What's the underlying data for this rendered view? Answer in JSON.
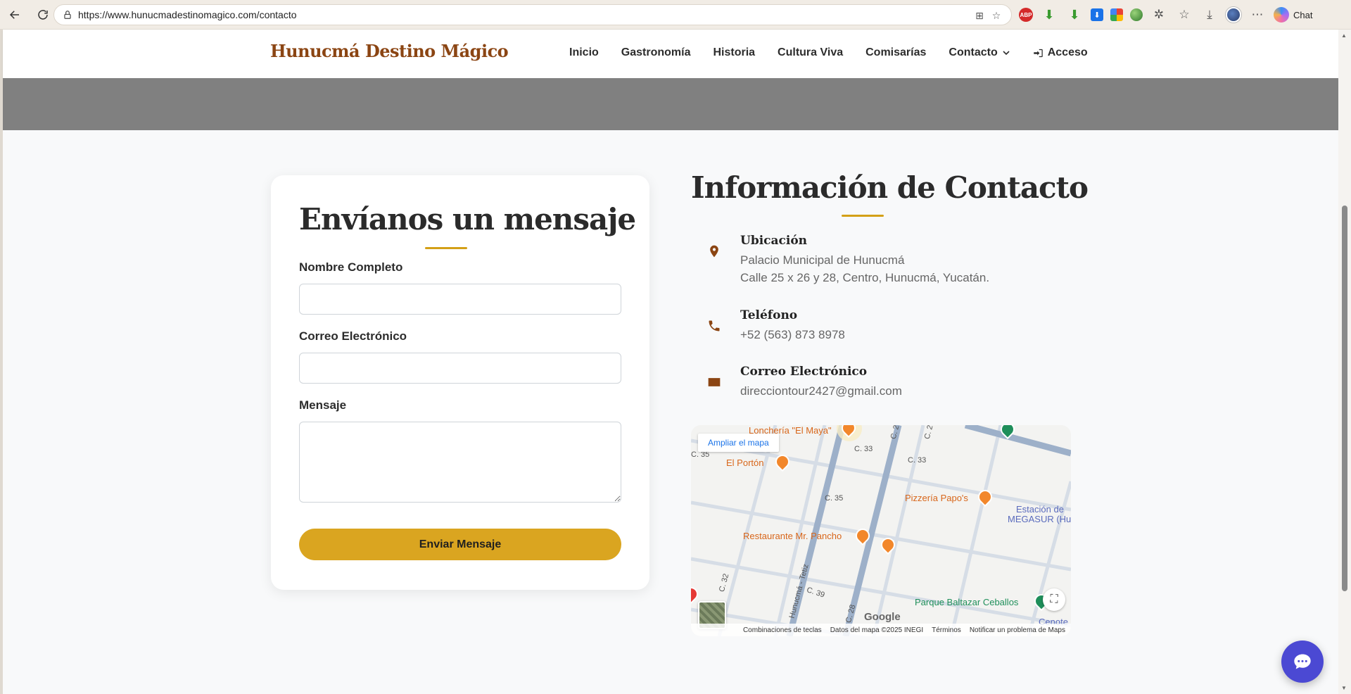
{
  "browser": {
    "url": "https://www.hunucmadestinomagico.com/contacto",
    "chat_label": "Chat",
    "abp_label": "ABP"
  },
  "site": {
    "brand": "Hunucmá Destino Mágico",
    "brand_color": "#8b4513",
    "accent_color": "#daa520",
    "nav": {
      "inicio": "Inicio",
      "gastronomia": "Gastronomía",
      "historia": "Historia",
      "cultura": "Cultura Viva",
      "comisarias": "Comisarías",
      "contacto": "Contacto",
      "acceso": "Acceso"
    }
  },
  "form": {
    "title": "Envíanos un mensaje",
    "name_label": "Nombre Completo",
    "name_value": "",
    "email_label": "Correo Electrónico",
    "email_value": "",
    "message_label": "Mensaje",
    "message_value": "",
    "submit_label": "Enviar Mensaje"
  },
  "contact": {
    "title": "Información de Contacto",
    "location_title": "Ubicación",
    "location_line1": "Palacio Municipal de Hunucmá",
    "location_line2": "Calle 25 x 26 y 28, Centro, Hunucmá, Yucatán.",
    "phone_title": "Teléfono",
    "phone_value": "+52 (563) 873 8978",
    "email_title": "Correo Electrónico",
    "email_value": "direcciontour2427@gmail.com"
  },
  "map": {
    "enlarge": "Ampliar el mapa",
    "pois": {
      "loncheria": "Lonchería \"El Maya\"",
      "porton": "El Portón",
      "papos": "Pizzería Papo's",
      "panchos": "Restaurante Mr. Pancho",
      "estacion1": "Estación de",
      "estacion2": "MEGASUR (Hu",
      "parque": "Parque Baltazar Ceballos",
      "cenote": "Cenote"
    },
    "streets": {
      "c33a": "C. 33",
      "c33b": "C. 33",
      "c35a": "C. 35",
      "c35b": "C. 35",
      "c32": "C. 32",
      "c39": "C. 39",
      "c28": "C. 28",
      "hunucma_tetiz": "Hunucmá - Tetiz",
      "c2a": "C. 2",
      "c2b": "C. 2"
    },
    "google": "Google",
    "footer": {
      "shortcuts": "Combinaciones de teclas",
      "data": "Datos del mapa ©2025 INEGI",
      "terms": "Términos",
      "report": "Notificar un problema de Maps"
    }
  }
}
